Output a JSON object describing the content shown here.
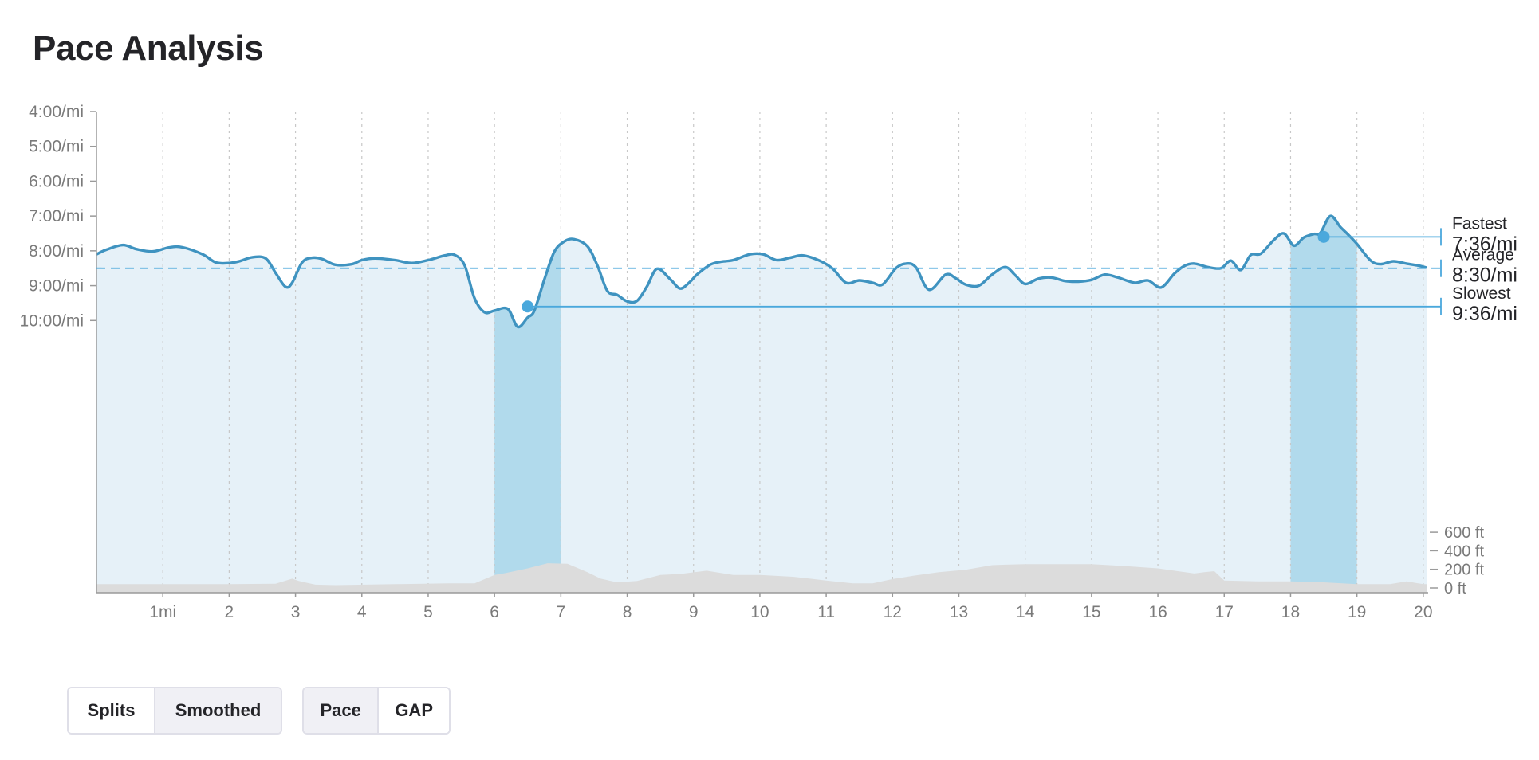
{
  "title": "Pace Analysis",
  "toggles": {
    "mode": [
      "Splits",
      "Smoothed"
    ],
    "mode_active": "Smoothed",
    "metric": [
      "Pace",
      "GAP"
    ],
    "metric_active": "Pace"
  },
  "colors": {
    "line": "#3f93c0",
    "area_fill": "#e6f1f8",
    "split_highlight": "#b1daec",
    "marker": "#4aa8dc",
    "elevation": "#dcdcdc",
    "grid": "#c8c8c8",
    "axis_text": "#7a7a7a"
  },
  "chart_data": {
    "type": "line",
    "title": "",
    "x_unit": "mi",
    "x_range": [
      0,
      20.05
    ],
    "x_ticks": [
      {
        "value": 1,
        "label": "1mi"
      },
      {
        "value": 2,
        "label": "2"
      },
      {
        "value": 3,
        "label": "3"
      },
      {
        "value": 4,
        "label": "4"
      },
      {
        "value": 5,
        "label": "5"
      },
      {
        "value": 6,
        "label": "6"
      },
      {
        "value": 7,
        "label": "7"
      },
      {
        "value": 8,
        "label": "8"
      },
      {
        "value": 9,
        "label": "9"
      },
      {
        "value": 10,
        "label": "10"
      },
      {
        "value": 11,
        "label": "11"
      },
      {
        "value": 12,
        "label": "12"
      },
      {
        "value": 13,
        "label": "13"
      },
      {
        "value": 14,
        "label": "14"
      },
      {
        "value": 15,
        "label": "15"
      },
      {
        "value": 16,
        "label": "16"
      },
      {
        "value": 17,
        "label": "17"
      },
      {
        "value": 18,
        "label": "18"
      },
      {
        "value": 19,
        "label": "19"
      },
      {
        "value": 20,
        "label": "20"
      }
    ],
    "y_unit": "seconds per mile (fast at top)",
    "y_range_top": 240,
    "y_range_bottom": 1069,
    "y_ticks": [
      {
        "value": 240,
        "label": "4:00/mi"
      },
      {
        "value": 300,
        "label": "5:00/mi"
      },
      {
        "value": 360,
        "label": "6:00/mi"
      },
      {
        "value": 420,
        "label": "7:00/mi"
      },
      {
        "value": 480,
        "label": "8:00/mi"
      },
      {
        "value": 540,
        "label": "9:00/mi"
      },
      {
        "value": 600,
        "label": "10:00/mi"
      }
    ],
    "series": [
      {
        "key": "pace",
        "x": [
          0,
          0.15,
          0.4,
          0.6,
          0.85,
          1.1,
          1.3,
          1.6,
          1.8,
          2.0,
          2.15,
          2.35,
          2.55,
          2.7,
          2.85,
          2.95,
          3.1,
          3.25,
          3.4,
          3.6,
          3.85,
          4.0,
          4.2,
          4.5,
          4.75,
          5.0,
          5.25,
          5.4,
          5.55,
          5.7,
          5.85,
          6.0,
          6.2,
          6.35,
          6.5,
          6.6,
          6.75,
          6.9,
          7.05,
          7.2,
          7.4,
          7.55,
          7.7,
          7.85,
          8.0,
          8.15,
          8.3,
          8.45,
          8.65,
          8.8,
          8.95,
          9.05,
          9.25,
          9.4,
          9.6,
          9.85,
          10.05,
          10.25,
          10.45,
          10.65,
          10.9,
          11.1,
          11.3,
          11.5,
          11.7,
          11.85,
          12.05,
          12.2,
          12.35,
          12.55,
          12.8,
          12.95,
          13.1,
          13.3,
          13.5,
          13.7,
          13.85,
          14.0,
          14.2,
          14.4,
          14.6,
          14.8,
          15.0,
          15.2,
          15.4,
          15.65,
          15.85,
          16.05,
          16.25,
          16.4,
          16.55,
          16.75,
          16.95,
          17.1,
          17.25,
          17.4,
          17.55,
          17.75,
          17.9,
          18.05,
          18.2,
          18.35,
          18.45,
          18.6,
          18.75,
          18.85,
          19.0,
          19.2,
          19.35,
          19.55,
          19.75,
          19.95,
          20.05
        ],
        "values": [
          486,
          478,
          470,
          477,
          481,
          474,
          474,
          486,
          500,
          501,
          498,
          491,
          493,
          518,
          542,
          535,
          500,
          492,
          494,
          504,
          503,
          496,
          493,
          496,
          501,
          496,
          488,
          487,
          505,
          562,
          586,
          583,
          580,
          611,
          595,
          583,
          530,
          482,
          464,
          460,
          472,
          505,
          549,
          556,
          567,
          566,
          541,
          511,
          529,
          545,
          533,
          521,
          504,
          499,
          496,
          486,
          486,
          496,
          492,
          488,
          497,
          511,
          535,
          531,
          535,
          538,
          510,
          502,
          508,
          547,
          521,
          527,
          538,
          540,
          521,
          508,
          522,
          537,
          528,
          526,
          532,
          533,
          530,
          521,
          526,
          535,
          531,
          543,
          519,
          506,
          502,
          508,
          510,
          497,
          513,
          487,
          485,
          461,
          450,
          471,
          457,
          451,
          449,
          420,
          439,
          450,
          468,
          496,
          503,
          498,
          502,
          506,
          509
        ]
      },
      {
        "key": "elevation",
        "unit": "ft",
        "x": [
          0,
          1,
          2,
          2.7,
          2.95,
          3.05,
          3.3,
          3.6,
          4.5,
          5.3,
          5.7,
          6.0,
          6.2,
          6.5,
          6.8,
          7.1,
          7.4,
          7.6,
          7.85,
          8.15,
          8.5,
          8.8,
          9.2,
          9.6,
          10.0,
          10.5,
          11.0,
          11.4,
          11.7,
          12.0,
          12.3,
          12.7,
          13.1,
          13.5,
          13.7,
          14.0,
          14.5,
          15.0,
          15.5,
          16.0,
          16.3,
          16.55,
          16.7,
          16.85,
          17.0,
          17.5,
          18.0,
          18.5,
          19.0,
          19.5,
          19.75,
          20.0,
          20.05
        ],
        "values": [
          40,
          40,
          40,
          45,
          100,
          75,
          35,
          30,
          40,
          50,
          50,
          140,
          165,
          210,
          265,
          260,
          170,
          100,
          60,
          75,
          140,
          150,
          185,
          140,
          140,
          120,
          80,
          50,
          50,
          95,
          130,
          170,
          195,
          245,
          250,
          255,
          255,
          255,
          235,
          210,
          180,
          155,
          170,
          180,
          80,
          70,
          70,
          60,
          40,
          40,
          70,
          40,
          40
        ]
      }
    ],
    "elevation_axis": [
      {
        "value": 600,
        "label": "600 ft"
      },
      {
        "value": 400,
        "label": "400 ft"
      },
      {
        "value": 200,
        "label": "200 ft"
      },
      {
        "value": 0,
        "label": "0 ft"
      }
    ],
    "highlighted_splits": [
      {
        "label": "slowest",
        "from": 6,
        "to": 7
      },
      {
        "label": "fastest",
        "from": 18,
        "to": 19
      }
    ],
    "reference_lines": [
      {
        "name": "Fastest",
        "value": 456,
        "value_label": "7:36/mi",
        "marker_x": 18.5,
        "style": "solid"
      },
      {
        "name": "Average",
        "value": 510,
        "value_label": "8:30/mi",
        "style": "dashed"
      },
      {
        "name": "Slowest",
        "value": 576,
        "value_label": "9:36/mi",
        "marker_x": 6.5,
        "style": "solid"
      }
    ],
    "grid": "vertical dotted at each mile",
    "legend": "right"
  }
}
